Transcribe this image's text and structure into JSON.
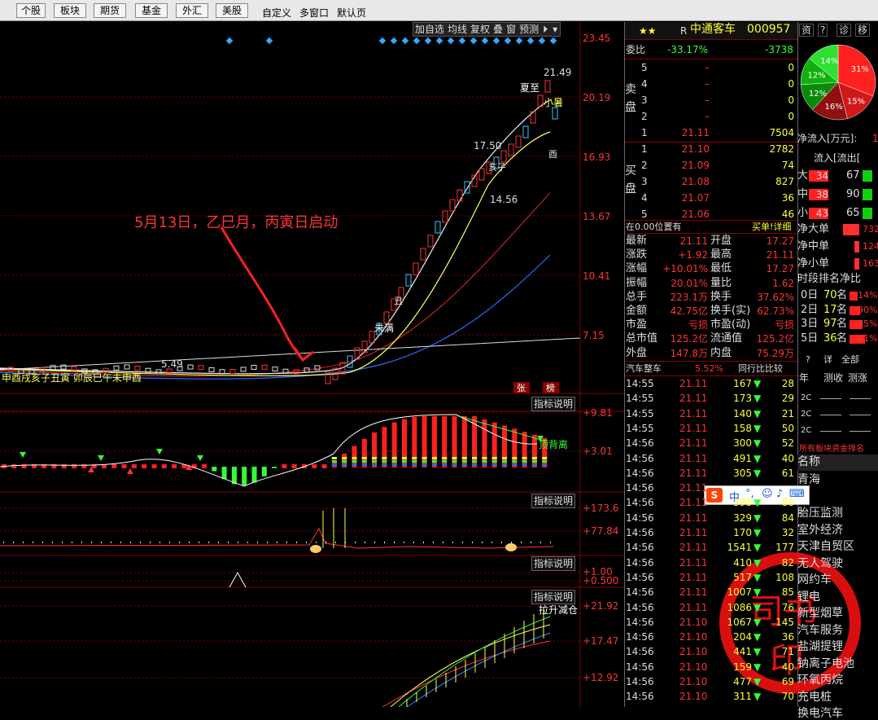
{
  "toolbar": {
    "tabs": [
      "个股",
      "板块",
      "期货",
      "基金",
      "外汇",
      "美股"
    ],
    "tools": [
      "自定义",
      "多窗口",
      "默认页"
    ]
  },
  "chart": {
    "top_buttons": [
      "加自选",
      "均线",
      "复权",
      "叠",
      "窗",
      "预测"
    ],
    "price_axis": [
      "23.45",
      "20.19",
      "16.93",
      "13.67",
      "10.41",
      "7.15"
    ],
    "annotation": "5月13日，乙巳月，丙寅日启动",
    "labels": {
      "high": "21.49",
      "mid": "17.50",
      "low": "14.56",
      "left1": "5.49",
      "solar_terms": [
        "夏至",
        "小暑"
      ],
      "dragon": "未满",
      "ding": "丁",
      "chou": "丑",
      "you": "酉",
      "hai": "亥子",
      "shen": "申",
      "yin": "寅"
    },
    "small_labels": [
      "张",
      "榜"
    ],
    "indicator_btn": "指标说明",
    "ind1_axis": [
      "+9.81",
      "+3.01"
    ],
    "ind1_tag": "顶背离",
    "ind2_axis": [
      "+173.6",
      "+77.84"
    ],
    "ind3_axis": [
      "+1.00",
      "+0.500"
    ],
    "ind4_axis": [
      "+21.92",
      "+17.47",
      "+12.92"
    ],
    "ind4_tag": "拉升减仓",
    "bottom_row_text": "申酉戌亥子丑寅 卯辰巳午未申酉"
  },
  "stock": {
    "stars": "★★",
    "prefix": "R",
    "name": "中通客车",
    "code": "000957",
    "weibi_label": "委比",
    "weibi": "-33.17%",
    "weicha": "-3738",
    "sell_label": "卖盘",
    "buy_label": "买盘",
    "sell": [
      {
        "n": "5",
        "p": "–",
        "v": "0"
      },
      {
        "n": "4",
        "p": "–",
        "v": "0"
      },
      {
        "n": "3",
        "p": "–",
        "v": "0"
      },
      {
        "n": "2",
        "p": "–",
        "v": "0"
      },
      {
        "n": "1",
        "p": "21.11",
        "v": "7504"
      }
    ],
    "buy": [
      {
        "n": "1",
        "p": "21.10",
        "v": "2782"
      },
      {
        "n": "2",
        "p": "21.09",
        "v": "74"
      },
      {
        "n": "3",
        "p": "21.08",
        "v": "827"
      },
      {
        "n": "4",
        "p": "21.07",
        "v": "36"
      },
      {
        "n": "5",
        "p": "21.06",
        "v": "46"
      }
    ],
    "pos_text": "在0.00位置有",
    "buy1_link": "买单!详细",
    "quote": [
      {
        "k1": "最新",
        "v1": "21.11",
        "k2": "开盘",
        "v2": "17.27"
      },
      {
        "k1": "涨跌",
        "v1": "+1.92",
        "k2": "最高",
        "v2": "21.11"
      },
      {
        "k1": "涨幅",
        "v1": "+10.01%",
        "k2": "最低",
        "v2": "17.27"
      },
      {
        "k1": "振幅",
        "v1": "20.01%",
        "k2": "量比",
        "v2": "1.62"
      },
      {
        "k1": "总手",
        "v1": "223.1万",
        "k2": "换手",
        "v2": "37.62%"
      },
      {
        "k1": "金额",
        "v1": "42.75亿",
        "k2": "换手(实)",
        "v2": "62.73%"
      },
      {
        "k1": "市盈",
        "v1": "亏损",
        "k2": "市盈(动)",
        "v2": "亏损"
      },
      {
        "k1": "总市值",
        "v1": "125.2亿",
        "k2": "流通值",
        "v2": "125.2亿"
      },
      {
        "k1": "外盘",
        "v1": "147.8万",
        "k2": "内盘",
        "v2": "75.29万"
      }
    ],
    "sector": "汽车整车",
    "sector_pct": "5.52%",
    "sector_btn": "同行比比较",
    "trades": [
      {
        "t": "14:55",
        "p": "21.11",
        "v": "167",
        "n": "28"
      },
      {
        "t": "14:55",
        "p": "21.11",
        "v": "173",
        "n": "29"
      },
      {
        "t": "14:55",
        "p": "21.11",
        "v": "140",
        "n": "21"
      },
      {
        "t": "14:55",
        "p": "21.11",
        "v": "158",
        "n": "50"
      },
      {
        "t": "14:56",
        "p": "21.11",
        "v": "300",
        "n": "52"
      },
      {
        "t": "14:56",
        "p": "21.11",
        "v": "491",
        "n": "40"
      },
      {
        "t": "14:56",
        "p": "21.11",
        "v": "305",
        "n": "61"
      },
      {
        "t": "14:56",
        "p": "21.11",
        "v": "",
        "n": ""
      },
      {
        "t": "14:56",
        "p": "21.11",
        "v": "398",
        "n": "86"
      },
      {
        "t": "14:56",
        "p": "21.11",
        "v": "329",
        "n": "84"
      },
      {
        "t": "14:56",
        "p": "21.11",
        "v": "170",
        "n": "32"
      },
      {
        "t": "14:56",
        "p": "21.11",
        "v": "1541",
        "n": "177"
      },
      {
        "t": "14:56",
        "p": "21.11",
        "v": "410",
        "n": "82"
      },
      {
        "t": "14:56",
        "p": "21.11",
        "v": "517",
        "n": "108"
      },
      {
        "t": "14:56",
        "p": "21.11",
        "v": "1007",
        "n": "85"
      },
      {
        "t": "14:56",
        "p": "21.11",
        "v": "1086",
        "n": "76"
      },
      {
        "t": "14:56",
        "p": "21.10",
        "v": "1067",
        "n": "145"
      },
      {
        "t": "14:56",
        "p": "21.10",
        "v": "204",
        "n": "36"
      },
      {
        "t": "14:56",
        "p": "21.10",
        "v": "441",
        "n": "71"
      },
      {
        "t": "14:56",
        "p": "21.10",
        "v": "159",
        "n": "40"
      },
      {
        "t": "14:56",
        "p": "21.10",
        "v": "477",
        "n": "69"
      },
      {
        "t": "14:56",
        "p": "21.10",
        "v": "311",
        "n": "70"
      }
    ],
    "trade_arrow": "▼"
  },
  "side": {
    "tabs": [
      "资",
      "?",
      "诊",
      "移"
    ],
    "pie": [
      {
        "label": "31%",
        "color": "#ff2020",
        "value": 31
      },
      {
        "label": "15%",
        "color": "#d01818",
        "value": 15
      },
      {
        "label": "16%",
        "color": "#901010",
        "value": 16
      },
      {
        "label": "12%",
        "color": "#0a8a0a",
        "value": 12
      },
      {
        "label": "12%",
        "color": "#10b010",
        "value": 12
      },
      {
        "label": "14%",
        "color": "#30e030",
        "value": 14
      }
    ],
    "flow_title": "净流入[万元]:",
    "flow_value": "1",
    "flow_head": "流入[流出[",
    "flow_rows": [
      {
        "k": "大",
        "a": "34",
        "b": "67"
      },
      {
        "k": "中",
        "a": "38",
        "b": "90"
      },
      {
        "k": "小",
        "a": "43",
        "b": "65"
      }
    ],
    "net_rows": [
      {
        "k": "净大单",
        "v": "732"
      },
      {
        "k": "净中单",
        "v": "124"
      },
      {
        "k": "净小单",
        "v": "163"
      }
    ],
    "rank_title": "时段排名净比",
    "rank_rows": [
      {
        "d": "0日",
        "n": "70",
        "pct": "14%"
      },
      {
        "d": "2日",
        "n": "17",
        "pct": "90%"
      },
      {
        "d": "3日",
        "n": "97",
        "pct": "95%"
      },
      {
        "d": "5日",
        "n": "36",
        "pct": "41%"
      }
    ],
    "rank_unit": "名",
    "mini_tabs": [
      "?",
      "详",
      "全部"
    ],
    "mini_head": [
      "年",
      "测收",
      "测涨"
    ],
    "mini_rows": [
      "2C",
      "2C",
      "2C"
    ],
    "list_title": "所有板块资金排名",
    "list_head": "名称",
    "list": [
      "青海",
      "",
      "胎压监测",
      "室外经济",
      "天津自贸区",
      "无人驾驶",
      "网约车",
      "锂电",
      "新型烟草",
      "汽车服务",
      "盐湖提锂",
      "钠离子电池",
      "环氧丙烷",
      "充电桩",
      "换电汽车"
    ],
    "ime_text": "中",
    "seal_text": "司书",
    "seal_text2": "印"
  }
}
